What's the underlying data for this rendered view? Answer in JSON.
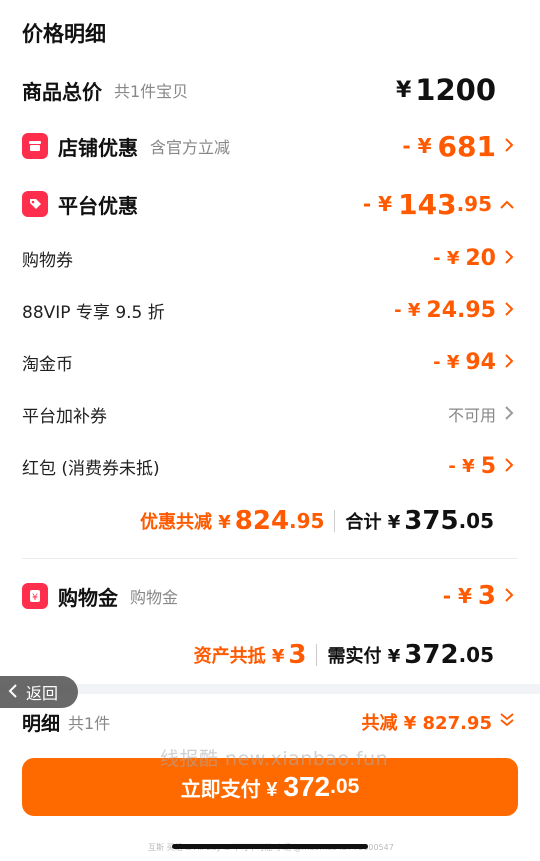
{
  "header": {
    "title": "价格明细"
  },
  "total": {
    "label": "商品总价",
    "sub": "共1件宝贝",
    "currency": "¥",
    "amount": "1200"
  },
  "shop_discount": {
    "label": "店铺优惠",
    "sub": "含官方立减",
    "prefix": "- ¥",
    "amount": "681"
  },
  "platform_discount": {
    "label": "平台优惠",
    "prefix": "- ¥",
    "amount_int": "143",
    "amount_dec": ".95"
  },
  "items": [
    {
      "label": "购物券",
      "prefix": "- ¥",
      "amount": "20"
    },
    {
      "label": "88VIP 专享 9.5 折",
      "prefix": "- ¥",
      "amount": "24.95"
    },
    {
      "label": "淘金币",
      "prefix": "- ¥",
      "amount": "94"
    },
    {
      "label": "平台加补券",
      "value": "不可用"
    },
    {
      "label": "红包 (消费券未抵)",
      "prefix": "- ¥",
      "amount": "5"
    }
  ],
  "summary": {
    "discount_label": "优惠共减 ¥",
    "discount_int": "824",
    "discount_dec": ".95",
    "total_label": "合计 ¥",
    "total_int": "375",
    "total_dec": ".05"
  },
  "shopping_gold": {
    "label": "购物金",
    "sub": "购物金",
    "prefix": "- ¥",
    "amount": "3"
  },
  "asset": {
    "offset_label": "资产共抵 ¥",
    "offset_amount": "3",
    "pay_label": "需实付 ¥",
    "pay_int": "372",
    "pay_dec": ".05"
  },
  "back": {
    "label": "返回"
  },
  "detail": {
    "label": "明细",
    "count": "共1件",
    "reduce_label": "共减 ¥ 827.95"
  },
  "watermark": "线报酷 new.xianbao.fun",
  "pay_button": {
    "label": "立即支付 ¥",
    "int": "372",
    "dec": ".05"
  },
  "footer_tiny": "互斯 买组 & All buy & 不可不可能 小组 @maomao ID: 73600547",
  "colors": {
    "accent": "#ff5a00",
    "button": "#ff6a00",
    "badge": "#ff2e4d"
  }
}
